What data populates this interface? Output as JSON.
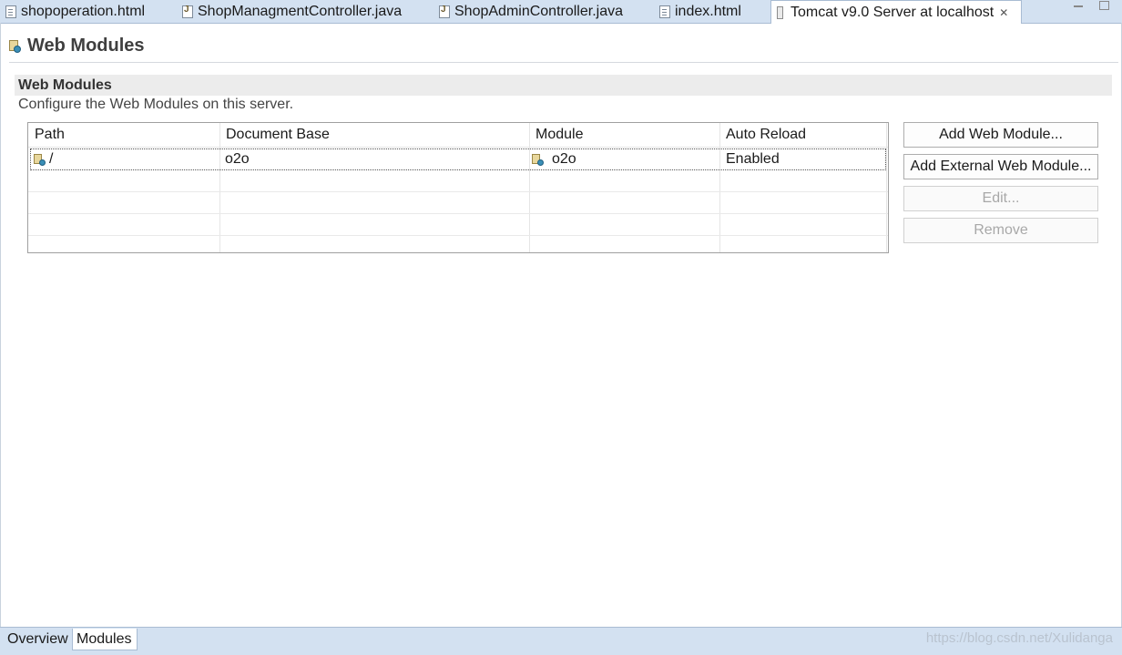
{
  "editor_tabs": [
    {
      "label": "shopoperation.html",
      "icon": "html-file-icon",
      "active": false
    },
    {
      "label": "ShopManagmentController.java",
      "icon": "java-file-icon",
      "active": false
    },
    {
      "label": "ShopAdminController.java",
      "icon": "java-file-icon",
      "active": false
    },
    {
      "label": "index.html",
      "icon": "html-file-icon",
      "active": false
    },
    {
      "label": "Tomcat v9.0 Server at localhost",
      "icon": "server-icon",
      "active": true,
      "close": "✕"
    }
  ],
  "page": {
    "title": "Web Modules"
  },
  "section": {
    "heading": "Web Modules",
    "description": "Configure the Web Modules on this server."
  },
  "table": {
    "columns": [
      "Path",
      "Document Base",
      "Module",
      "Auto Reload"
    ],
    "rows": [
      {
        "path": "/",
        "document_base": "o2o",
        "module": "o2o",
        "auto_reload": "Enabled"
      }
    ]
  },
  "buttons": {
    "add_web_module": "Add Web Module...",
    "add_external_web_module": "Add External Web Module...",
    "edit": "Edit...",
    "remove": "Remove"
  },
  "page_tabs": [
    {
      "label": "Overview",
      "active": false
    },
    {
      "label": "Modules",
      "active": true
    }
  ],
  "watermark": "https://blog.csdn.net/Xulidanga",
  "colors": {
    "tab_bar": "#d3e1f1",
    "section_header": "#ececec",
    "disabled_text": "#a8a8a8"
  }
}
